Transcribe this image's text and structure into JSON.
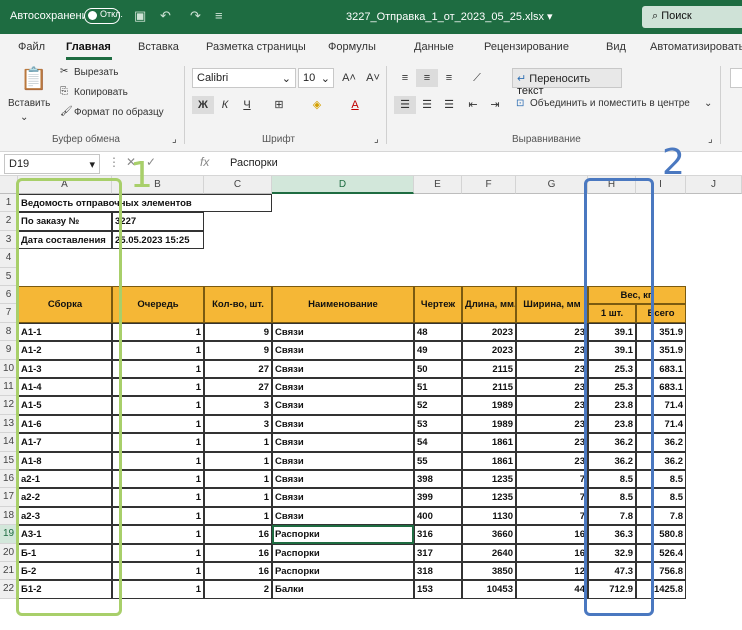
{
  "titlebar": {
    "autosave_label": "Автосохранение",
    "autosave_state": "Откл.",
    "filename": "3227_Отправка_1_от_2023_05_25.xlsx ▾",
    "search_label": "Поиск"
  },
  "tabs": [
    "Файл",
    "Главная",
    "Вставка",
    "Разметка страницы",
    "Формулы",
    "Данные",
    "Рецензирование",
    "Вид",
    "Автоматизировать"
  ],
  "ribbon": {
    "paste_label": "Вставить",
    "cut_label": "Вырезать",
    "copy_label": "Копировать",
    "format_painter_label": "Формат по образцу",
    "clipboard_group": "Буфер обмена",
    "font_name": "Calibri",
    "font_size": "10",
    "font_group": "Шрифт",
    "wrap_text_label": "Переносить текст",
    "merge_label": "Объединить и поместить в центре",
    "alignment_group": "Выравнивание"
  },
  "formula_bar": {
    "cell_ref": "D19",
    "fx": "fx",
    "content": "Распорки"
  },
  "columns": [
    "A",
    "B",
    "C",
    "D",
    "E",
    "F",
    "G",
    "H",
    "I",
    "J"
  ],
  "rows": [
    "1",
    "2",
    "3",
    "4",
    "5",
    "6",
    "7",
    "8",
    "9",
    "10",
    "11",
    "12",
    "13",
    "14",
    "15",
    "16",
    "17",
    "18",
    "19",
    "20",
    "21",
    "22"
  ],
  "sheet": {
    "info": [
      {
        "label": "Ведомость отправочных элементов",
        "value": ""
      },
      {
        "label": "По заказу №",
        "value": "3227"
      },
      {
        "label": "Дата составления",
        "value": "25.05.2023 15:25"
      }
    ],
    "headers": {
      "assembly": "Сборка",
      "queue": "Очередь",
      "qty": "Кол-во, шт.",
      "name": "Наименование",
      "drawing": "Чертеж",
      "length": "Длина, мм.",
      "width": "Ширина, мм",
      "weight": "Вес, кг.",
      "weight_one": "1 шт.",
      "weight_total": "Всего"
    },
    "data": [
      [
        "А1-1",
        "1",
        "9",
        "Связи",
        "48",
        "2023",
        "23",
        "39.1",
        "351.9"
      ],
      [
        "А1-2",
        "1",
        "9",
        "Связи",
        "49",
        "2023",
        "23",
        "39.1",
        "351.9"
      ],
      [
        "А1-3",
        "1",
        "27",
        "Связи",
        "50",
        "2115",
        "23",
        "25.3",
        "683.1"
      ],
      [
        "А1-4",
        "1",
        "27",
        "Связи",
        "51",
        "2115",
        "23",
        "25.3",
        "683.1"
      ],
      [
        "А1-5",
        "1",
        "3",
        "Связи",
        "52",
        "1989",
        "23",
        "23.8",
        "71.4"
      ],
      [
        "А1-6",
        "1",
        "3",
        "Связи",
        "53",
        "1989",
        "23",
        "23.8",
        "71.4"
      ],
      [
        "А1-7",
        "1",
        "1",
        "Связи",
        "54",
        "1861",
        "23",
        "36.2",
        "36.2"
      ],
      [
        "А1-8",
        "1",
        "1",
        "Связи",
        "55",
        "1861",
        "23",
        "36.2",
        "36.2"
      ],
      [
        "а2-1",
        "1",
        "1",
        "Связи",
        "398",
        "1235",
        "7",
        "8.5",
        "8.5"
      ],
      [
        "а2-2",
        "1",
        "1",
        "Связи",
        "399",
        "1235",
        "7",
        "8.5",
        "8.5"
      ],
      [
        "а2-3",
        "1",
        "1",
        "Связи",
        "400",
        "1130",
        "7",
        "7.8",
        "7.8"
      ],
      [
        "А3-1",
        "1",
        "16",
        "Распорки",
        "316",
        "3660",
        "16",
        "36.3",
        "580.8"
      ],
      [
        "Б-1",
        "1",
        "16",
        "Распорки",
        "317",
        "2640",
        "16",
        "32.9",
        "526.4"
      ],
      [
        "Б-2",
        "1",
        "16",
        "Распорки",
        "318",
        "3850",
        "12",
        "47.3",
        "756.8"
      ],
      [
        "Б1-2",
        "1",
        "2",
        "Балки",
        "153",
        "10453",
        "44",
        "712.9",
        "1425.8"
      ]
    ]
  },
  "annotations": [
    {
      "label": "1",
      "color": "#a8cf6a"
    },
    {
      "label": "2",
      "color": "#4a78c0"
    }
  ]
}
